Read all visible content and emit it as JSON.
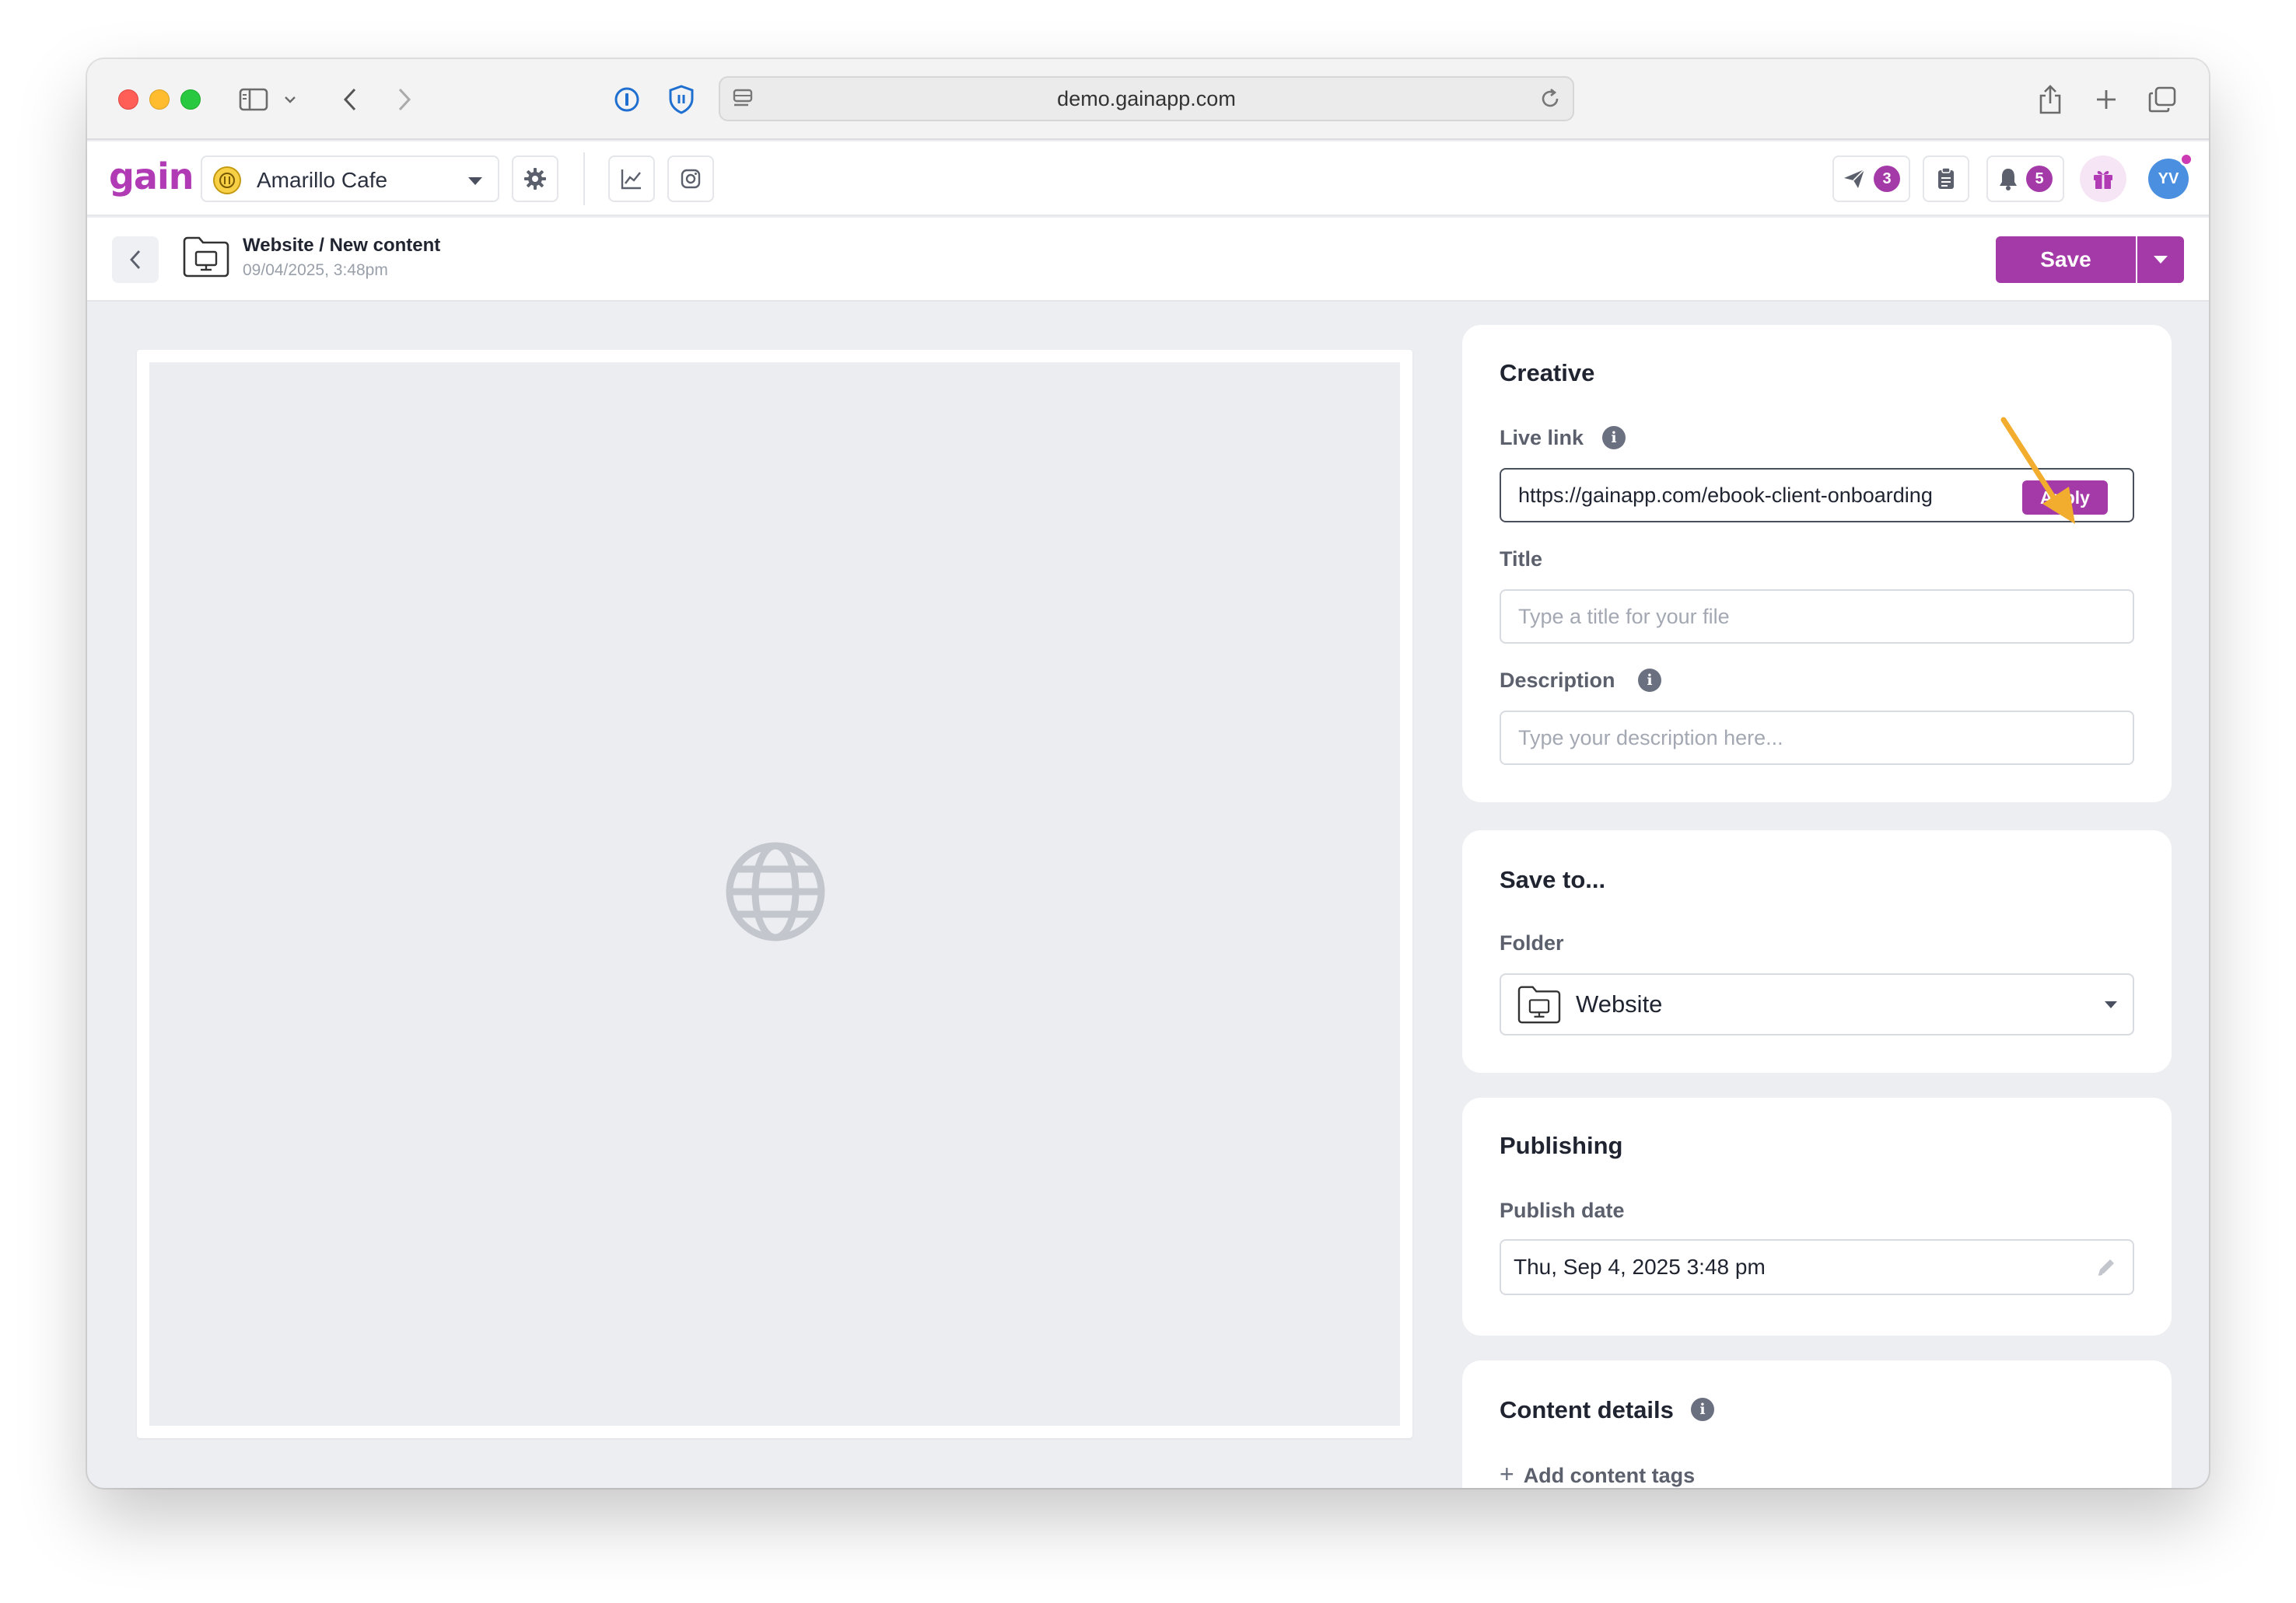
{
  "browser": {
    "url": "demo.gainapp.com"
  },
  "appbar": {
    "logo": "gain",
    "brand_name": "Amarillo Cafe",
    "approvals_count": "3",
    "notifications_count": "5",
    "user_initials": "YV"
  },
  "subheader": {
    "breadcrumb": "Website / New content",
    "date": "09/04/2025, 3:48pm",
    "save_label": "Save"
  },
  "creative": {
    "title": "Creative",
    "live_link_label": "Live link",
    "live_link_value": "https://gainapp.com/ebook-client-onboarding",
    "apply_label": "Apply",
    "title_label": "Title",
    "title_placeholder": "Type a title for your file",
    "description_label": "Description",
    "description_placeholder": "Type your description here..."
  },
  "save_to": {
    "title": "Save to...",
    "folder_label": "Folder",
    "folder_value": "Website"
  },
  "publishing": {
    "title": "Publishing",
    "publish_date_label": "Publish date",
    "publish_date_value": "Thu, Sep 4, 2025 3:48 pm"
  },
  "content_details": {
    "title": "Content details",
    "add_tags_label": "Add content tags"
  },
  "colors": {
    "brand": "#a43aa8",
    "annotation_arrow": "#f2ad2e"
  }
}
